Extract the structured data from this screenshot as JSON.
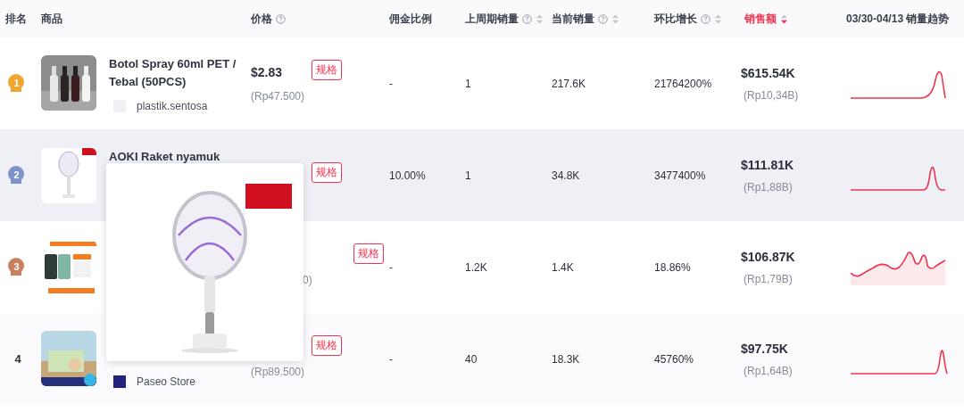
{
  "columns": [
    {
      "label": "排名",
      "help": false,
      "sortable": false,
      "selected": false
    },
    {
      "label": "商品",
      "help": false,
      "sortable": false,
      "selected": false
    },
    {
      "label": "价格",
      "help": true,
      "sortable": false,
      "selected": false
    },
    {
      "label": "佣金比例",
      "help": false,
      "sortable": false,
      "selected": false
    },
    {
      "label": "上周期销量",
      "help": true,
      "sortable": true,
      "selected": false
    },
    {
      "label": "当前销量",
      "help": true,
      "sortable": true,
      "selected": false
    },
    {
      "label": "环比增长",
      "help": true,
      "sortable": true,
      "selected": false
    },
    {
      "label": "销售额",
      "help": false,
      "sortable": true,
      "selected": true
    },
    {
      "label": "03/30-04/13 销量趋势",
      "help": false,
      "sortable": false,
      "selected": false
    }
  ],
  "rows": [
    {
      "rank": "1",
      "kind": "medal",
      "color": "#f0a62e",
      "selected": false,
      "title": "Botol Spray 60ml PET / Tebal (50PCS)",
      "store": "plastik.sentosa",
      "price": "$2.83",
      "price_local": "(Rp47.500)",
      "spec": "规格",
      "commission": "-",
      "last_sales": "1",
      "current_sales": "217.6K",
      "growth": "21764200%",
      "revenue": "$615.54K",
      "revenue_local": "(Rp10,34B)"
    },
    {
      "rank": "2",
      "kind": "medal",
      "color": "#7f93c9",
      "selected": true,
      "title": "AOKI Raket nyamuk",
      "spec": "规格",
      "commission": "10.00%",
      "last_sales": "1",
      "current_sales": "34.8K",
      "growth": "3477400%",
      "revenue": "$111.81K",
      "revenue_local": "(Rp1,88B)"
    },
    {
      "rank": "3",
      "kind": "medal",
      "color": "#c9805f",
      "selected": false,
      "price_local": "0)",
      "spec": "规格",
      "commission": "-",
      "last_sales": "1.2K",
      "current_sales": "1.4K",
      "growth": "18.86%",
      "revenue": "$106.87K",
      "revenue_local": "(Rp1,79B)"
    },
    {
      "rank": "4",
      "kind": "plain",
      "selected": false,
      "store": "Paseo Store",
      "price_local": "(Rp89.500)",
      "spec": "规格",
      "commission": "-",
      "last_sales": "40",
      "current_sales": "18.3K",
      "growth": "45760%",
      "revenue": "$97.75K",
      "revenue_local": "(Rp1,64B)"
    }
  ]
}
